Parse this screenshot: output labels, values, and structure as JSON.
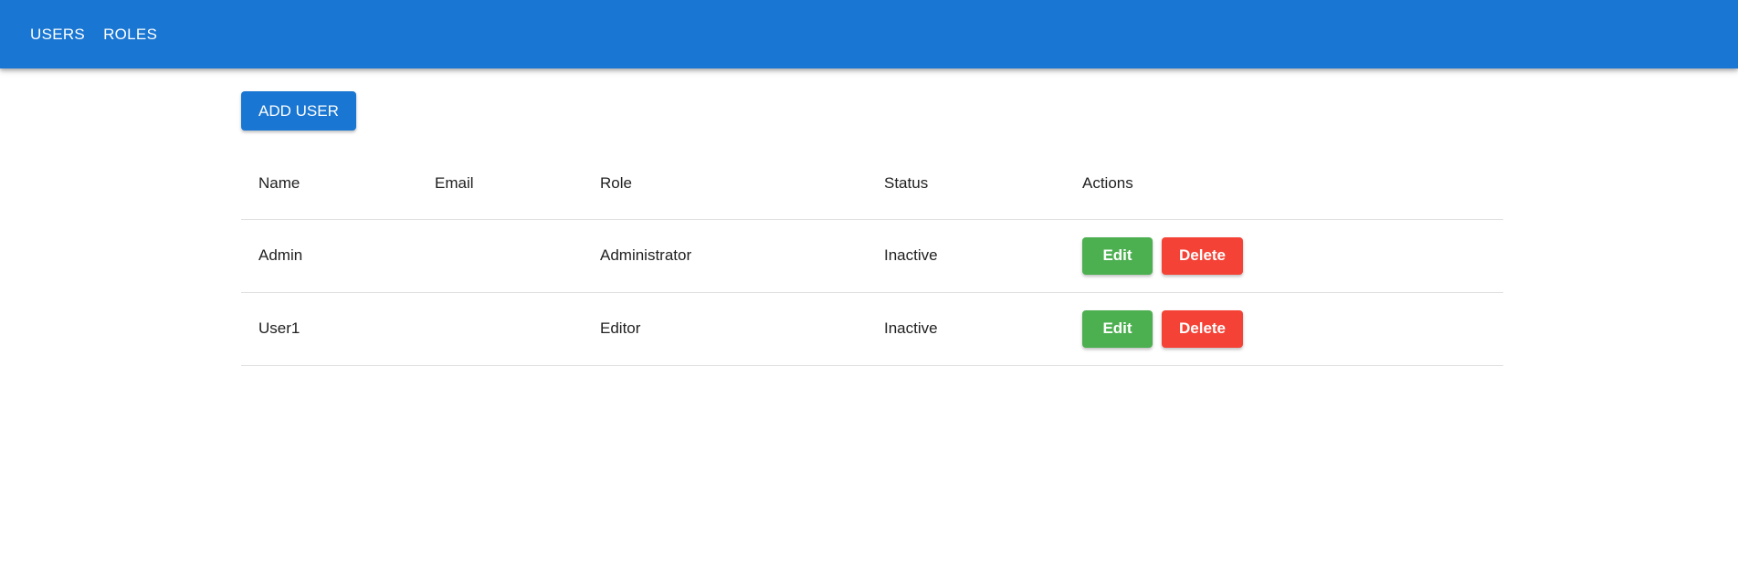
{
  "nav": {
    "items": [
      {
        "label": "USERS"
      },
      {
        "label": "ROLES"
      }
    ]
  },
  "toolbar": {
    "add_label": "ADD USER"
  },
  "table": {
    "headers": {
      "name": "Name",
      "email": "Email",
      "role": "Role",
      "status": "Status",
      "actions": "Actions"
    },
    "rows": [
      {
        "name": "Admin",
        "email": "",
        "role": "Administrator",
        "status": "Inactive",
        "edit_label": "Edit",
        "delete_label": "Delete"
      },
      {
        "name": "User1",
        "email": "",
        "role": "Editor",
        "status": "Inactive",
        "edit_label": "Edit",
        "delete_label": "Delete"
      }
    ]
  },
  "colors": {
    "primary": "#1976d2",
    "edit": "#4caf50",
    "delete": "#f44336"
  }
}
